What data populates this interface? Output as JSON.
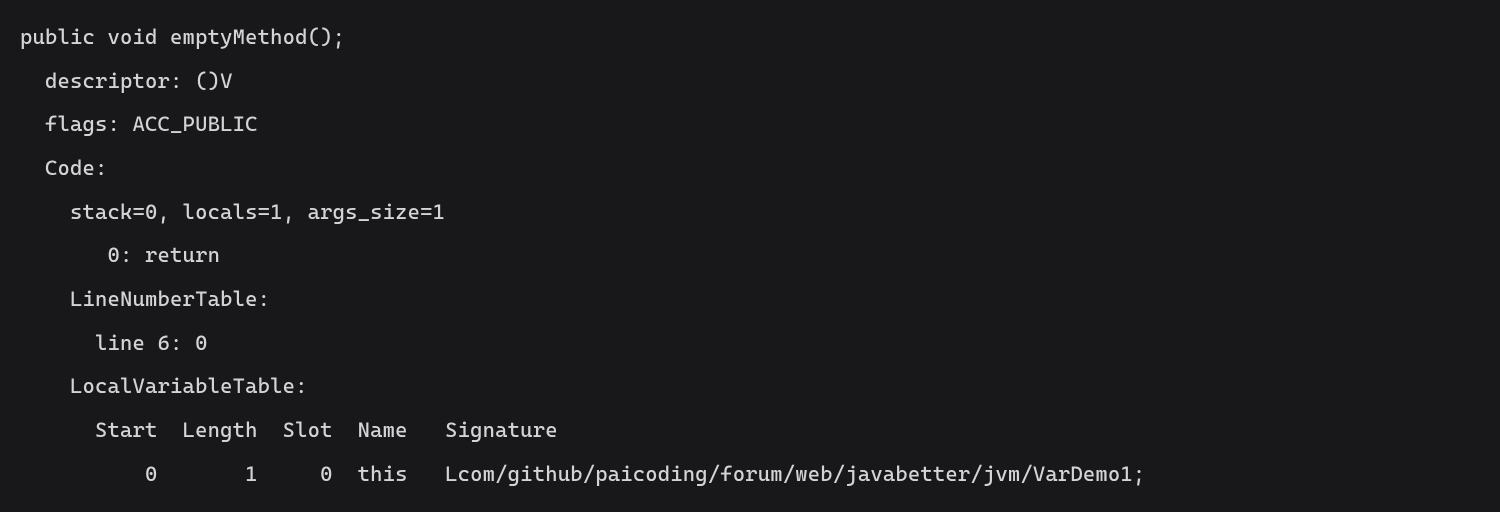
{
  "code": {
    "line1": "public void emptyMethod();",
    "line2": "  descriptor: ()V",
    "line3": "  flags: ACC_PUBLIC",
    "line4": "  Code:",
    "line5": "    stack=0, locals=1, args_size=1",
    "line6": "       0: return",
    "line7": "    LineNumberTable:",
    "line8": "      line 6: 0",
    "line9": "    LocalVariableTable:",
    "line10": "      Start  Length  Slot  Name   Signature",
    "line11": "          0       1     0  this   Lcom/github/paicoding/forum/web/javabetter/jvm/VarDemo1;"
  },
  "javap": {
    "method_signature": "public void emptyMethod();",
    "descriptor": "()V",
    "flags": "ACC_PUBLIC",
    "stack": 0,
    "locals": 1,
    "args_size": 1,
    "bytecode": [
      {
        "offset": 0,
        "instruction": "return"
      }
    ],
    "line_number_table": [
      {
        "source_line": 6,
        "bytecode_offset": 0
      }
    ],
    "local_variable_table": {
      "columns": [
        "Start",
        "Length",
        "Slot",
        "Name",
        "Signature"
      ],
      "rows": [
        {
          "Start": 0,
          "Length": 1,
          "Slot": 0,
          "Name": "this",
          "Signature": "Lcom/github/paicoding/forum/web/javabetter/jvm/VarDemo1;"
        }
      ]
    }
  }
}
